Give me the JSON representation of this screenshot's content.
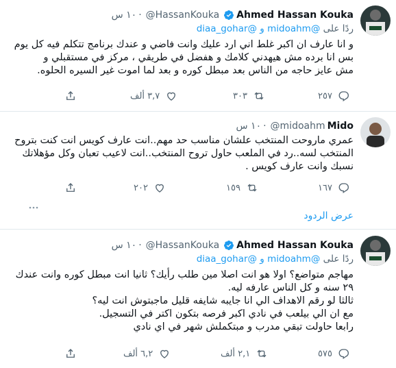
{
  "tweets": [
    {
      "name": "Ahmed Hassan Kouka",
      "handle": "@HassanKouka",
      "time": "١٠ س",
      "replying_prefix": "ردًا على",
      "replying_mentions": "@midoahm و @diaa_gohar",
      "text": "و انا عارف ان اكبر غلط اني ارد عليك وانت فاضي و عندك برنامج تتكلم فيه كل يوم\nبس انا برده مش هيهدني كلامك و هفضل في طريقي ، مركز في مستقبلي و\nمش عايز حاجه من الناس بعد مبطل كوره و بعد لما اموت غير السيره الحلوه.",
      "replies": "٢٥٧",
      "retweets": "٣٠٣",
      "likes": "٣,٧ ألف"
    },
    {
      "name": "Mido",
      "handle": "@midoahm",
      "time": "١٠ س",
      "text": "عمري ماروحت المنتخب علشان مناسب حد مهم..انت عارف كويس انت كنت بتروح\nالمنتخب لسه..رد في الملعب حاول تروح المنتخب..انت لاعيب تعبان وكل مؤهلاتك\nنسبك وانت عارف كويس .",
      "replies": "١٦٧",
      "retweets": "١٥٩",
      "likes": "٢٠٢"
    },
    {
      "name": "Ahmed Hassan Kouka",
      "handle": "@HassanKouka",
      "time": "١٠ س",
      "replying_prefix": "ردًا على",
      "replying_mentions": "@midoahm و @diaa_gohar",
      "text": "مهاجم متواضع؟ اولا هو انت اصلا مين طلب رأيك؟ ثانيا انت مبطل كوره وانت عندك\n٢٩ سنه و كل الناس عارفه ليه.\nثالثا لو رقم الاهداف الي انا جايبه شايفه قليل ماجبتوش انت ليه؟\nمع ان الي بيلعب في نادي اكبر فرصه بتكون اكتر في التسجيل.\nرابعا حاولت تبقي مدرب و مبتكملش شهر في اي نادي",
      "replies": "٥٧٥",
      "retweets": "٢,١ ألف",
      "likes": "٦,٢ ألف"
    }
  ],
  "show_replies": "عرض الردود",
  "colors": {
    "accent": "#1d9bf0",
    "muted": "#536471",
    "text": "#0f1419",
    "divider": "#e1e8ed"
  },
  "icons": [
    "verified-badge-icon",
    "reply-icon",
    "retweet-icon",
    "like-icon",
    "share-icon",
    "more-icon"
  ]
}
